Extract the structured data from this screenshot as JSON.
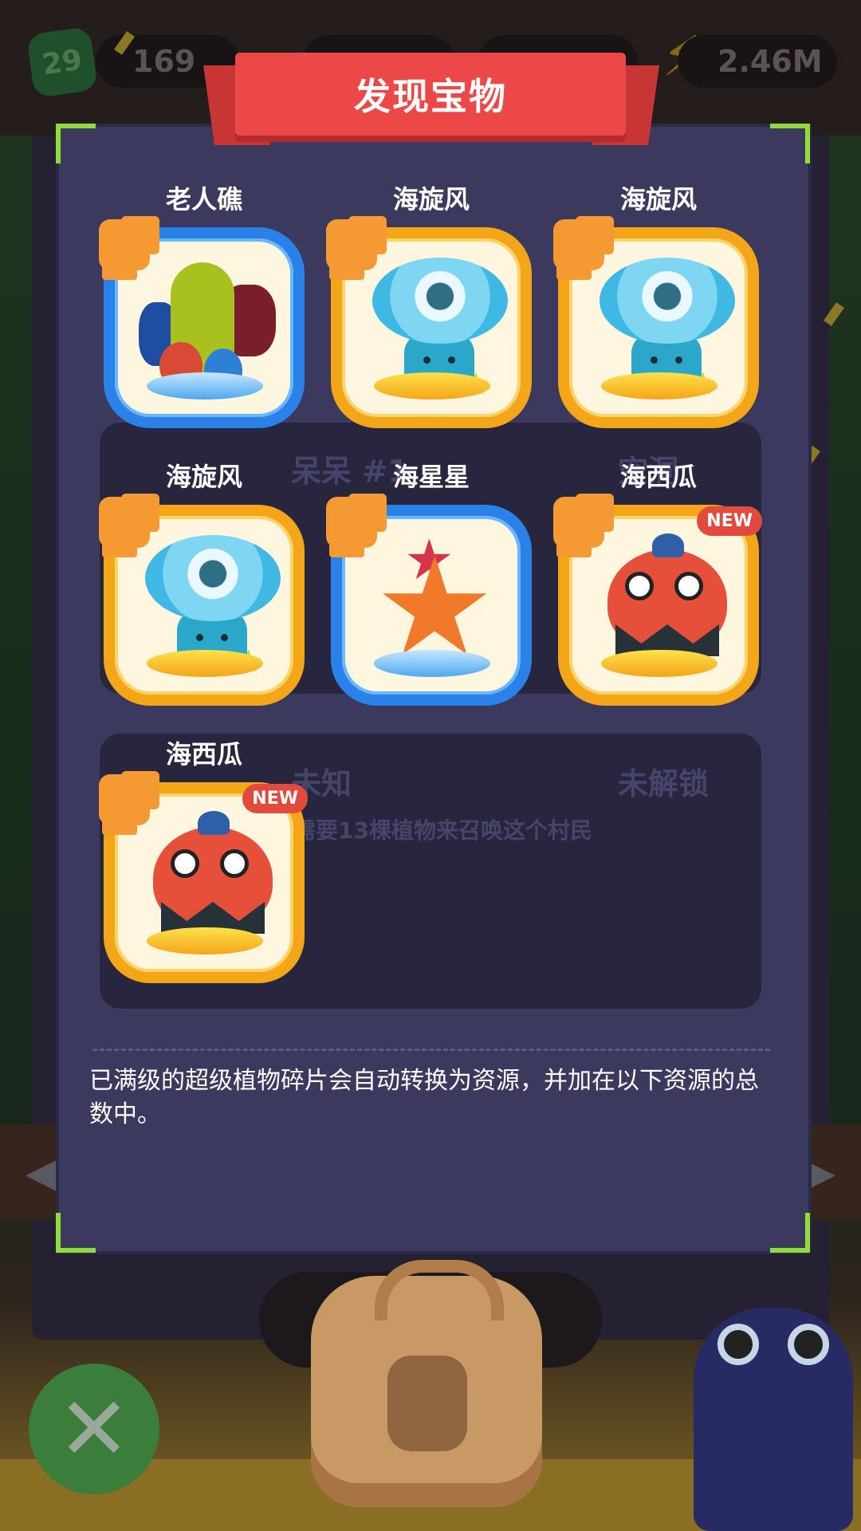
{
  "topbar": {
    "level": "29",
    "resource_1": "169",
    "energy": "2.46M"
  },
  "dialog": {
    "title": "发现宝物",
    "items": [
      {
        "name": "老人礁",
        "frame": "blue",
        "is_new": false,
        "creature": "rock-cactus"
      },
      {
        "name": "海旋风",
        "frame": "gold",
        "is_new": false,
        "creature": "sea-whirlwind"
      },
      {
        "name": "海旋风",
        "frame": "gold",
        "is_new": false,
        "creature": "sea-whirlwind"
      },
      {
        "name": "海旋风",
        "frame": "gold",
        "is_new": false,
        "creature": "sea-whirlwind"
      },
      {
        "name": "海星星",
        "frame": "blue",
        "is_new": false,
        "creature": "starfish"
      },
      {
        "name": "海西瓜",
        "frame": "gold",
        "is_new": true,
        "creature": "sea-melon"
      },
      {
        "name": "海西瓜",
        "frame": "gold",
        "is_new": true,
        "creature": "sea-melon"
      }
    ],
    "new_badge": "NEW",
    "background_labels": {
      "row2_left": "呆呆 #1",
      "row2_right": "空洞",
      "row3_left": "未知",
      "row3_right": "未解锁",
      "row3_hint": "还需要13棵植物来召唤这个村民"
    },
    "info_text": "已满级的超级植物碎片会自动转换为资源，并加在以下资源的总数中。"
  },
  "controls": {
    "close_icon": "close-x-icon",
    "nav_left_icon": "arrow-left-icon",
    "nav_right_icon": "arrow-right-icon"
  },
  "colors": {
    "gold_frame": "#f3a618",
    "blue_frame": "#2a82e8",
    "ribbon": "#ec4848",
    "corner_accent": "#8fdc3a",
    "dialog_bg": "#3b3a5e"
  }
}
